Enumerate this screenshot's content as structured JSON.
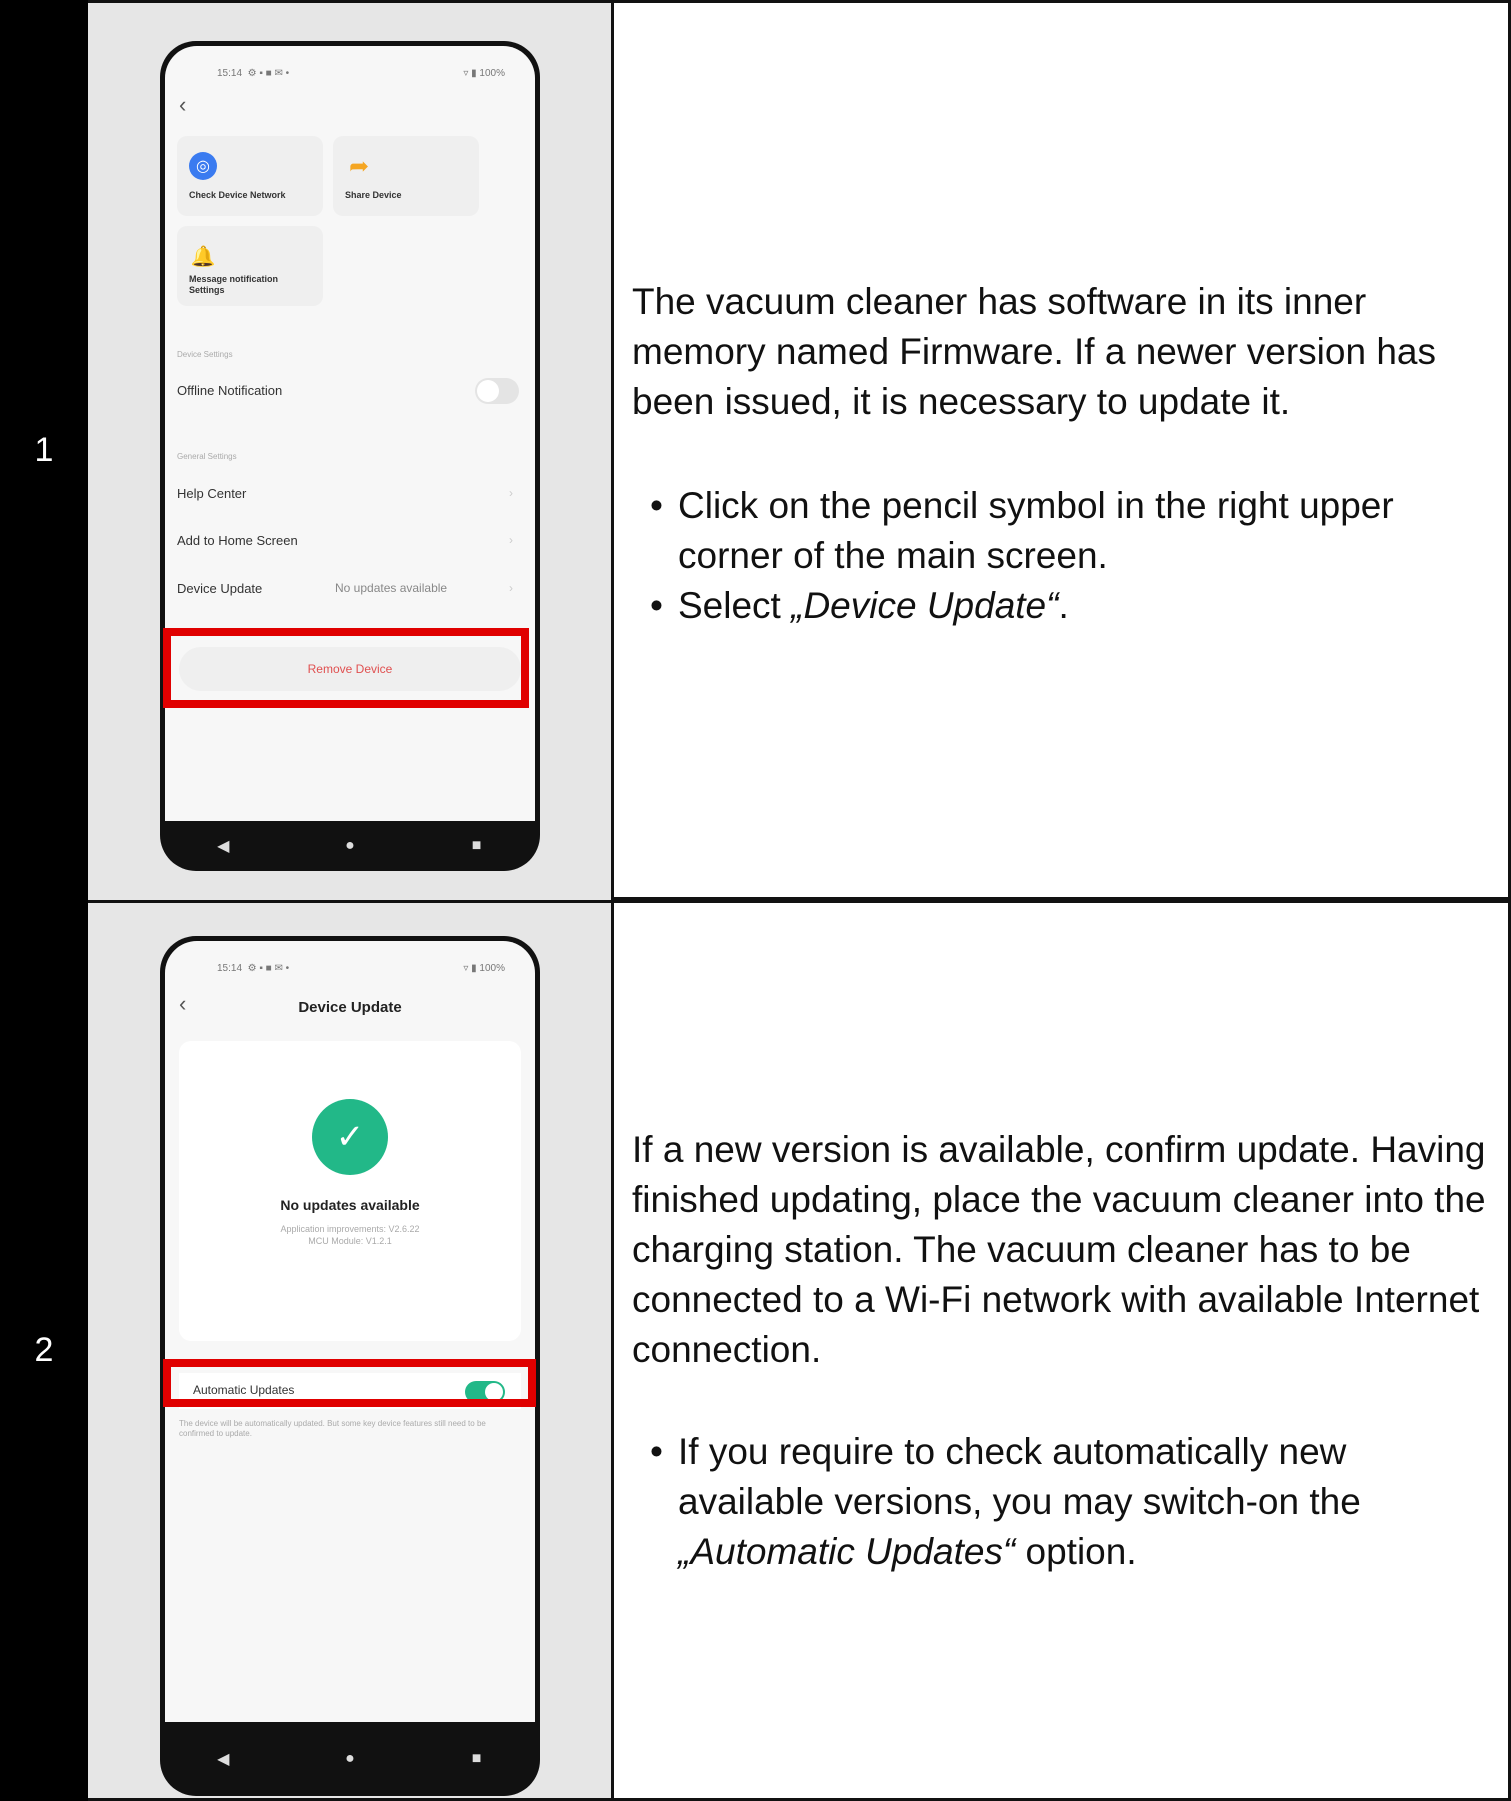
{
  "steps": [
    {
      "number": "1",
      "phone": {
        "status_time": "15:14",
        "status_icons": "⚙ ▪ ■ ✉ •",
        "status_right": "▿ ▮ 100%",
        "tiles": {
          "check_network": "Check Device Network",
          "share_device": "Share Device",
          "message_notification": "Message notification Settings"
        },
        "section_device_settings": "Device Settings",
        "offline_notification": "Offline Notification",
        "section_general_settings": "General Settings",
        "help_center": "Help Center",
        "add_to_home": "Add to Home Screen",
        "device_update": "Device Update",
        "device_update_value": "No updates available",
        "remove_device": "Remove Device"
      },
      "text": "The vacuum cleaner has software in its inner memory named Firmware. If a newer version has been issued, it is necessary to update it.",
      "bullet1": "Click on the pencil symbol in the right upper corner of the main screen.",
      "bullet2_prefix": "Select ",
      "bullet2_em": "„Device Update“",
      "bullet2_suffix": "."
    },
    {
      "number": "2",
      "phone": {
        "status_time": "15:14",
        "status_icons": "⚙ ▪ ■ ✉ •",
        "status_right": "▿ ▮ 100%",
        "title": "Device Update",
        "no_updates": "No updates available",
        "app_improvements": "Application improvements: V2.6.22",
        "mcu_module": "MCU Module: V1.2.1",
        "automatic_updates": "Automatic Updates",
        "note": "The device will be automatically updated. But some key device features still need to be confirmed to update."
      },
      "text": "If a new version is available, confirm update. Having finished updating, place the vacuum cleaner into the charging station. The vacuum cleaner has to be connected to a Wi-Fi network with available Internet connection.",
      "bullet1_prefix": "If you require to check automatically new available versions, you may switch-on the ",
      "bullet1_em": "„Automatic Updates“",
      "bullet1_suffix": " option."
    }
  ],
  "icons": {
    "nav_back": "◀",
    "nav_home": "●",
    "nav_recent": "■",
    "back_arrow": "‹",
    "network_icon": "◎",
    "share_icon": "➦",
    "bell_icon": "🔔",
    "check_icon": "✓"
  },
  "colors": {
    "highlight": "#e00000",
    "accent_green": "#22b888"
  }
}
